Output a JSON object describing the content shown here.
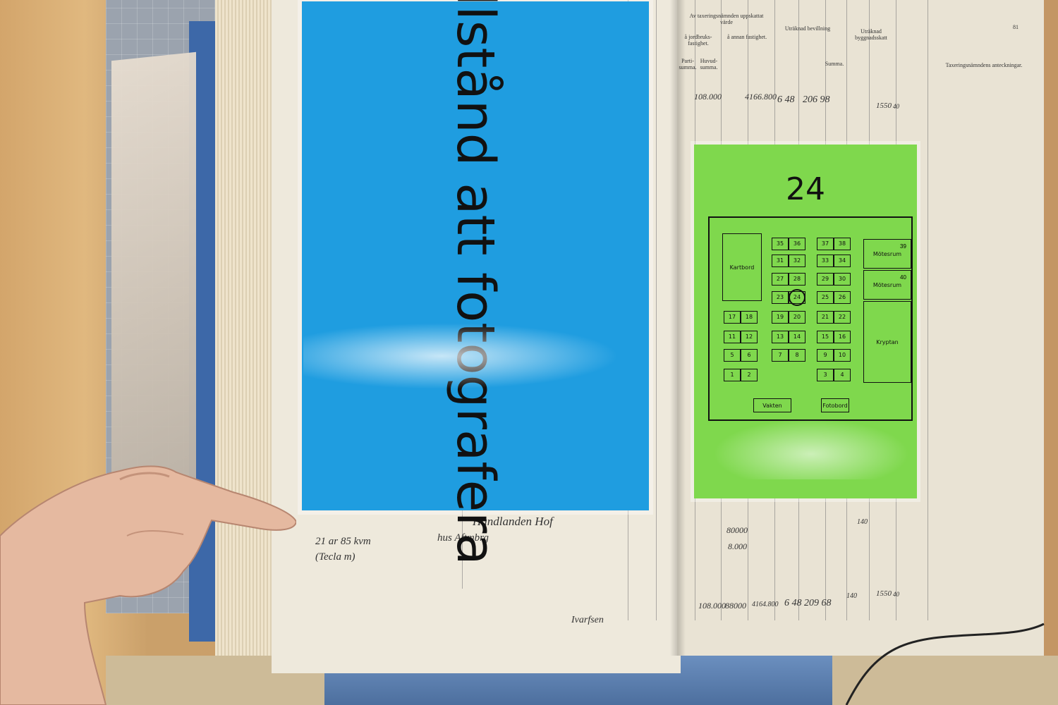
{
  "blue_sign": {
    "text": "Tillstånd att fotografera",
    "color": "#1f9de0"
  },
  "green_sign": {
    "color": "#7fd84d",
    "number": "24",
    "rooms": {
      "kartbord": "Kartbord",
      "motesrum_1": "Mötesrum",
      "motesrum_2": "Mötesrum",
      "kryptan": "Kryptan",
      "vakten": "Vakten",
      "fotobord": "Fotobord"
    },
    "room_numbers": {
      "motesrum_1": "39",
      "motesrum_2": "40"
    },
    "seats": [
      "35",
      "36",
      "37",
      "38",
      "31",
      "32",
      "33",
      "34",
      "27",
      "28",
      "29",
      "30",
      "23",
      "24",
      "25",
      "26",
      "17",
      "18",
      "19",
      "20",
      "21",
      "22",
      "11",
      "12",
      "13",
      "14",
      "15",
      "16",
      "5",
      "6",
      "7",
      "8",
      "9",
      "10",
      "1",
      "2",
      "3",
      "4"
    ],
    "selected_seat": "24"
  },
  "ledger": {
    "header_top": "Av taxeringsnämnden uppskattat värde",
    "header_jordbruk": "å jordbruks-fastighet.",
    "header_annan": "å annan fastighet.",
    "header_utraknad": "Uträknad bevillning",
    "header_bygg": "Uträknad byggnadsskatt",
    "header_anteckningar": "Taxeringsnämndens anteckningar.",
    "header_parti": "Parti-summa.",
    "header_huvud": "Huvud-summa.",
    "header_summa": "Summa.",
    "page_number": "81",
    "row1": [
      "108.000",
      "4166.800",
      "6 48",
      "206 98",
      "1550",
      "40"
    ],
    "handwritten_left_1": "Handlanden Hof",
    "handwritten_left_2": "hus Aftmbrg",
    "handwritten_left_3": "21 ar 85 kvm",
    "handwritten_left_4": "(Tecla m)",
    "totals": [
      "108.000",
      "88000",
      "4164.800",
      "6 48",
      "209 68",
      "140",
      "1550",
      "40"
    ],
    "mid_values": [
      "80000",
      "8.000",
      "140"
    ],
    "signature": "Ivarfsen"
  }
}
